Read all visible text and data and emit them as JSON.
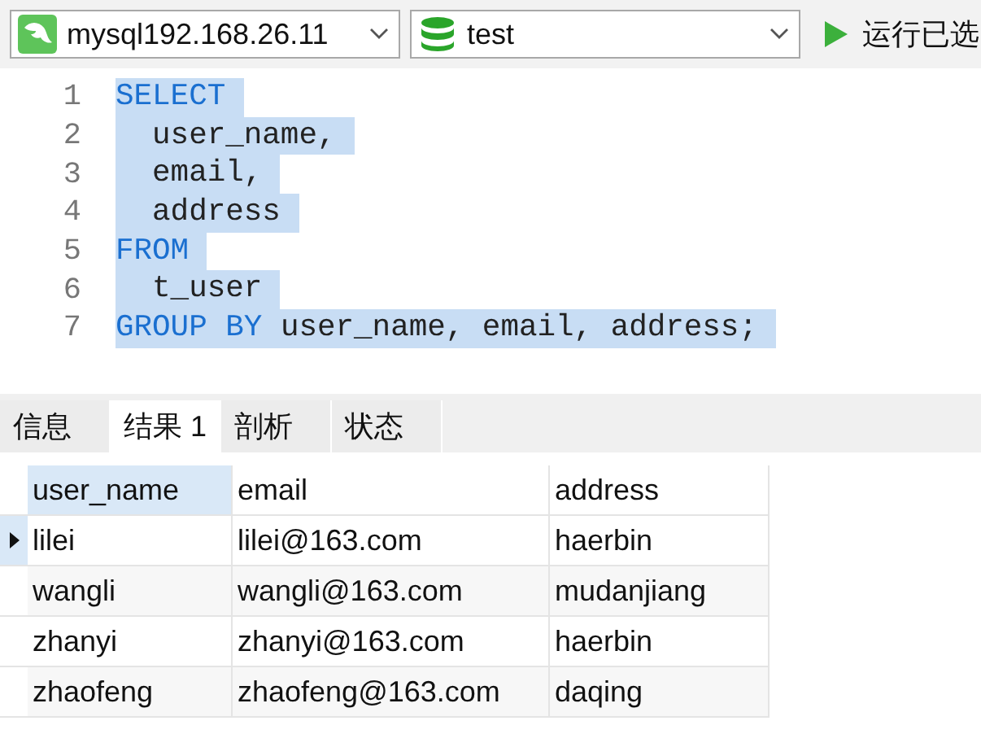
{
  "toolbar": {
    "connection": {
      "value": "mysql192.168.26.11"
    },
    "database": {
      "value": "test"
    },
    "run_button": {
      "label": "运行已选"
    }
  },
  "editor": {
    "lines": [
      {
        "number": "1",
        "selected": true,
        "tokens": [
          {
            "text": "SELECT",
            "kind": "keyword"
          }
        ]
      },
      {
        "number": "2",
        "selected": true,
        "tokens": [
          {
            "text": "  user_name,",
            "kind": "plain"
          }
        ]
      },
      {
        "number": "3",
        "selected": true,
        "tokens": [
          {
            "text": "  email,",
            "kind": "plain"
          }
        ]
      },
      {
        "number": "4",
        "selected": true,
        "tokens": [
          {
            "text": "  address",
            "kind": "plain"
          }
        ]
      },
      {
        "number": "5",
        "selected": true,
        "tokens": [
          {
            "text": "FROM",
            "kind": "keyword"
          }
        ]
      },
      {
        "number": "6",
        "selected": true,
        "tokens": [
          {
            "text": "  t_user",
            "kind": "plain"
          }
        ]
      },
      {
        "number": "7",
        "selected": true,
        "tokens": [
          {
            "text": "GROUP BY",
            "kind": "keyword"
          },
          {
            "text": " user_name, email, address;",
            "kind": "plain"
          }
        ]
      }
    ]
  },
  "tabs": [
    {
      "label": "信息",
      "selected": false
    },
    {
      "label": "结果 1",
      "selected": true
    },
    {
      "label": "剖析",
      "selected": false
    },
    {
      "label": "状态",
      "selected": false
    }
  ],
  "table": {
    "columns": [
      {
        "label": "user_name",
        "selected": true
      },
      {
        "label": "email",
        "selected": false
      },
      {
        "label": "address",
        "selected": false
      }
    ],
    "rows": [
      {
        "current": true,
        "cells": [
          "lilei",
          "lilei@163.com",
          "haerbin"
        ]
      },
      {
        "current": false,
        "cells": [
          "wangli",
          "wangli@163.com",
          "mudanjiang"
        ]
      },
      {
        "current": false,
        "cells": [
          "zhanyi",
          "zhanyi@163.com",
          "haerbin"
        ]
      },
      {
        "current": false,
        "cells": [
          "zhaofeng",
          "zhaofeng@163.com",
          "daqing"
        ]
      }
    ]
  }
}
